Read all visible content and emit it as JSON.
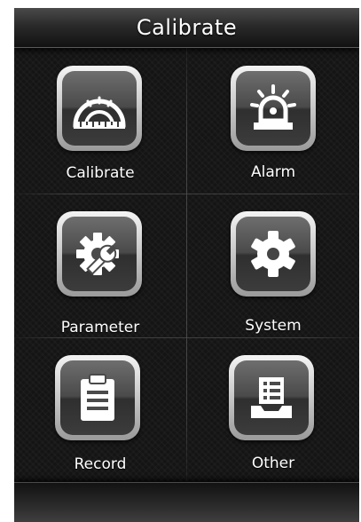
{
  "window": {
    "title": "Calibrate"
  },
  "menu": {
    "items": [
      {
        "label": "Calibrate",
        "icon": "protractor-icon"
      },
      {
        "label": "Alarm",
        "icon": "alarm-light-icon"
      },
      {
        "label": "Parameter",
        "icon": "gear-wrench-icon"
      },
      {
        "label": "System",
        "icon": "gear-icon"
      },
      {
        "label": "Record",
        "icon": "clipboard-icon"
      },
      {
        "label": "Other",
        "icon": "inbox-list-icon"
      }
    ]
  },
  "colors": {
    "background": "#141414",
    "icon_glyph": "#ffffff",
    "text": "#ffffff"
  }
}
